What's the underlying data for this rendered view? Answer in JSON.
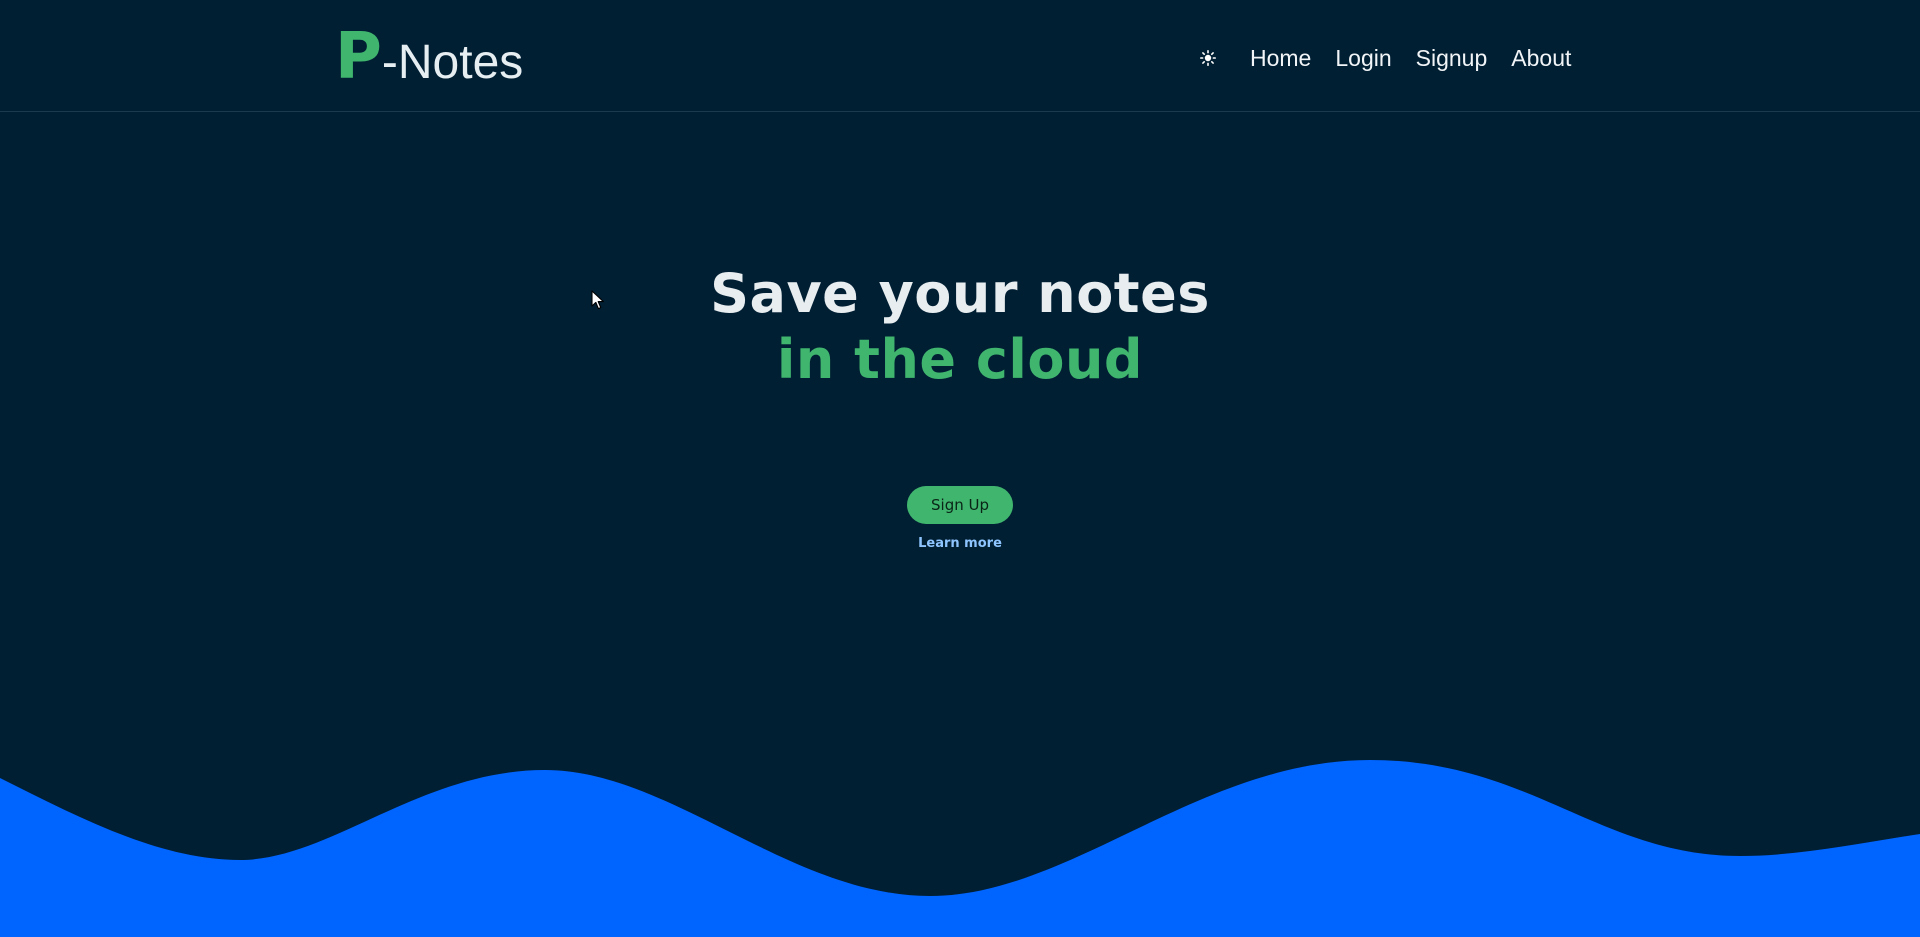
{
  "brand": {
    "letter": "P",
    "rest": "-Notes"
  },
  "nav": {
    "theme_icon": "sun-icon",
    "links": [
      "Home",
      "Login",
      "Signup",
      "About"
    ]
  },
  "hero": {
    "line1": "Save your notes",
    "line2": "in the cloud",
    "signup_label": "Sign Up",
    "learn_more_label": "Learn more"
  },
  "colors": {
    "background": "#011f33",
    "accent_green": "#3fb56e",
    "link_blue": "#8ec5ff",
    "wave_blue": "#0064ff"
  }
}
